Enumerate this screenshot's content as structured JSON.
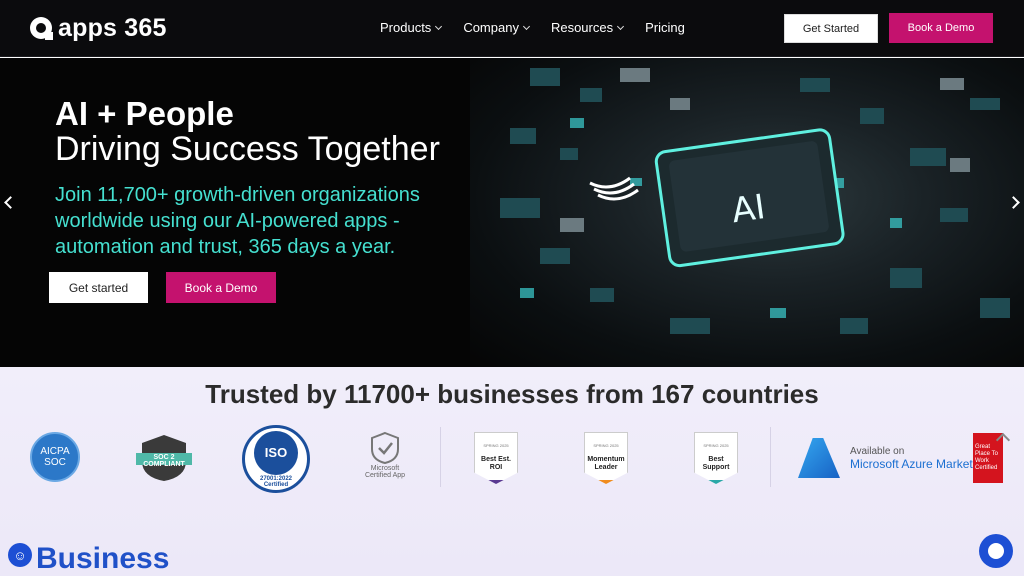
{
  "nav": {
    "logo": "apps 365",
    "menu": [
      "Products",
      "Company",
      "Resources",
      "Pricing"
    ],
    "get_started": "Get Started",
    "book_demo": "Book a Demo"
  },
  "hero": {
    "title_line1": "AI + People",
    "title_line2": "Driving Success Together",
    "subtitle": "Join 11,700+ growth-driven organizations worldwide using our AI-powered apps - automation and trust, 365 days a year.",
    "chip_label": "AI",
    "get_started": "Get started",
    "book_demo": "Book a Demo"
  },
  "trust": {
    "title": "Trusted by 11700+ businesses from 167 countries",
    "badges": {
      "aicpa": "AICPA SOC",
      "soc2": "SOC 2 COMPLIANT",
      "iso_code": "ISO",
      "iso_sub": "27001:2022",
      "iso_caption": "Certified",
      "ms_cert": "Microsoft Certified App",
      "g2_season": "SPRING 2025",
      "g2_1": "Best Est. ROI",
      "g2_2": "Momentum Leader",
      "g2_3": "Best Support",
      "azure_small": "Available on",
      "azure_main": "Microsoft Azure Marketplace",
      "gptw": "Great Place To Work Certified"
    }
  },
  "section": {
    "heading": "Business"
  },
  "colors": {
    "brand_pink": "#c4126e",
    "accent_teal": "#45e0d0",
    "link_blue": "#2051c8"
  }
}
